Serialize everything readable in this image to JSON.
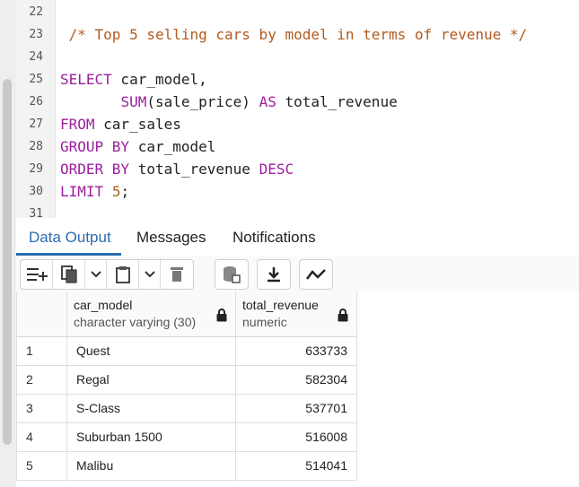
{
  "editor": {
    "lines": [
      {
        "num": "22",
        "segments": []
      },
      {
        "num": "23",
        "segments": [
          {
            "t": " /* Top 5 selling cars by model in terms of revenue */",
            "c": "cm"
          }
        ]
      },
      {
        "num": "24",
        "segments": []
      },
      {
        "num": "25",
        "segments": [
          {
            "t": "SELECT",
            "c": "kw"
          },
          {
            "t": " car_model,",
            "c": "plain"
          }
        ]
      },
      {
        "num": "26",
        "segments": [
          {
            "t": "       ",
            "c": "plain"
          },
          {
            "t": "SUM",
            "c": "kw"
          },
          {
            "t": "(sale_price) ",
            "c": "plain"
          },
          {
            "t": "AS",
            "c": "kw"
          },
          {
            "t": " total_revenue",
            "c": "plain"
          }
        ]
      },
      {
        "num": "27",
        "segments": [
          {
            "t": "FROM",
            "c": "kw"
          },
          {
            "t": " car_sales",
            "c": "plain"
          }
        ]
      },
      {
        "num": "28",
        "segments": [
          {
            "t": "GROUP BY",
            "c": "kw"
          },
          {
            "t": " car_model",
            "c": "plain"
          }
        ]
      },
      {
        "num": "29",
        "segments": [
          {
            "t": "ORDER BY",
            "c": "kw"
          },
          {
            "t": " total_revenue ",
            "c": "plain"
          },
          {
            "t": "DESC",
            "c": "kw"
          }
        ]
      },
      {
        "num": "30",
        "segments": [
          {
            "t": "LIMIT",
            "c": "kw"
          },
          {
            "t": " ",
            "c": "plain"
          },
          {
            "t": "5",
            "c": "num"
          },
          {
            "t": ";",
            "c": "plain"
          }
        ]
      },
      {
        "num": "31",
        "segments": []
      }
    ]
  },
  "tabs": {
    "data_output": "Data Output",
    "messages": "Messages",
    "notifications": "Notifications"
  },
  "toolbar": {
    "icons": [
      "add-row-icon",
      "copy-icon",
      "chevron-down-icon",
      "paste-icon",
      "chevron-down-icon",
      "delete-icon",
      "save-data-icon",
      "download-icon",
      "graph-icon"
    ]
  },
  "grid": {
    "columns": [
      {
        "name": "car_model",
        "type": "character varying (30)"
      },
      {
        "name": "total_revenue",
        "type": "numeric"
      }
    ],
    "rows": [
      {
        "num": "1",
        "car_model": "Quest",
        "total_revenue": "633733"
      },
      {
        "num": "2",
        "car_model": "Regal",
        "total_revenue": "582304"
      },
      {
        "num": "3",
        "car_model": "S-Class",
        "total_revenue": "537701"
      },
      {
        "num": "4",
        "car_model": "Suburban 1500",
        "total_revenue": "516008"
      },
      {
        "num": "5",
        "car_model": "Malibu",
        "total_revenue": "514041"
      }
    ]
  },
  "colors": {
    "keyword": "#9c1e9c",
    "comment": "#b2591d",
    "number": "#a4661d",
    "accent": "#2a6db0"
  }
}
